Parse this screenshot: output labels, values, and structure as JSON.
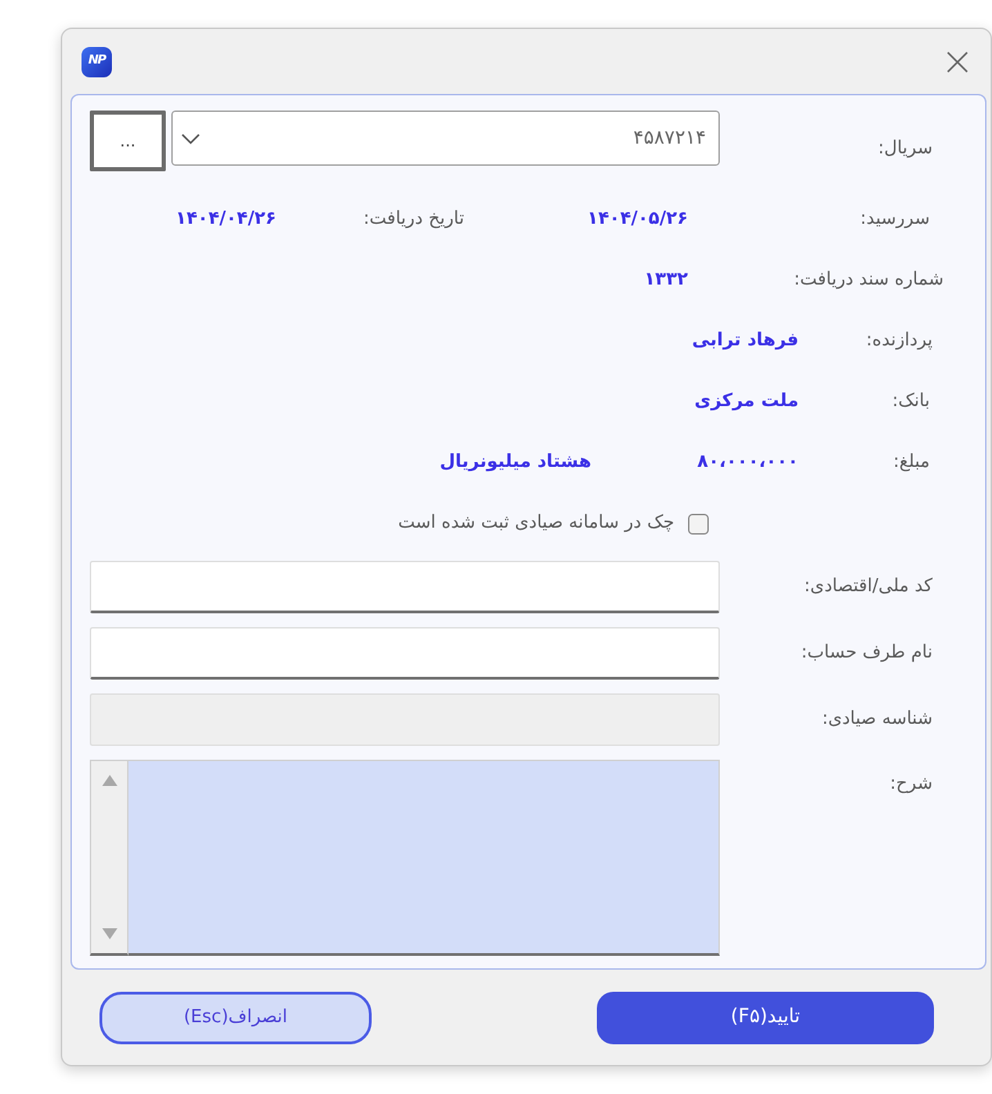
{
  "window": {
    "logo": "NP"
  },
  "serial": {
    "label": "سریال:",
    "value": "۴۵۸۷۲۱۴",
    "browse_button": "..."
  },
  "due_date": {
    "label": "سررسید:",
    "value": "۱۴۰۴/۰۵/۲۶"
  },
  "receipt_date": {
    "label": "تاریخ دریافت:",
    "value": "۱۴۰۴/۰۴/۲۶"
  },
  "receipt_document_number": {
    "label": "شماره سند دریافت:",
    "value": "۱۳۳۲"
  },
  "payer": {
    "label": "پردازنده:",
    "value": "فرهاد ترابی"
  },
  "bank": {
    "label": "بانک:",
    "value": "ملت مرکزی"
  },
  "amount": {
    "label": "مبلغ:",
    "value": "۸۰،۰۰۰،۰۰۰",
    "in_words": "هشتاد میلیونریال"
  },
  "sayad_registered": {
    "label": "چک در سامانه صیادی ثبت شده است",
    "checked": false
  },
  "fields": [
    {
      "label": "کد ملی/اقتصادی:",
      "disabled": false
    },
    {
      "label": "نام طرف حساب:",
      "disabled": false
    },
    {
      "label": "شناسه صیادی:",
      "disabled": true
    }
  ],
  "description": {
    "label": "شرح:"
  },
  "buttons": [
    {
      "label": "تایید(F۵)",
      "kind": "primary"
    },
    {
      "label": "انصراف(Esc)",
      "kind": "secondary"
    }
  ]
}
